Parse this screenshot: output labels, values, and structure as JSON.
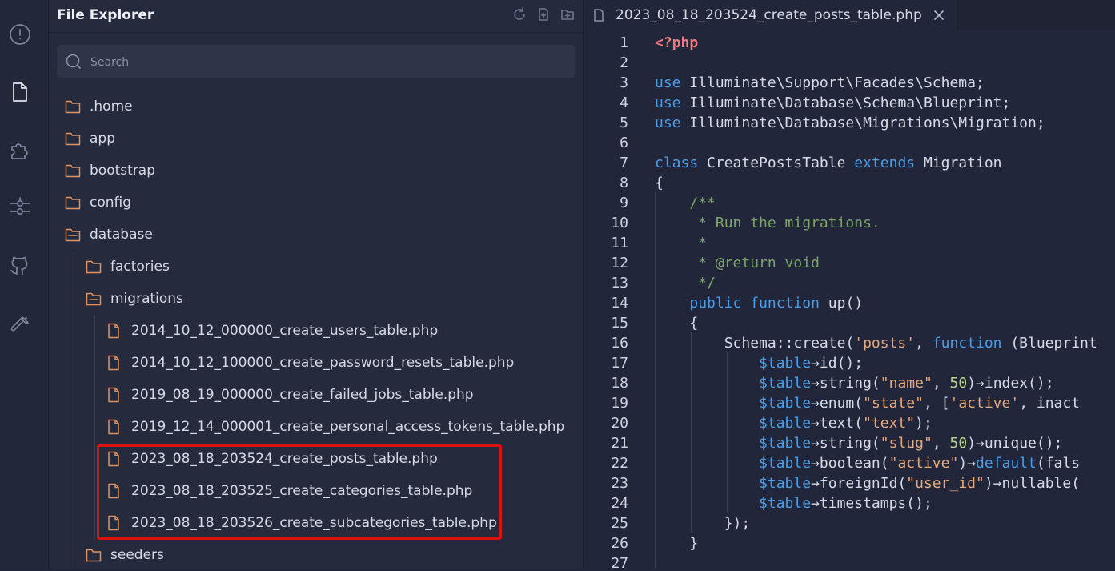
{
  "activity_bar": {
    "icons": [
      "alert-circle-icon",
      "file-icon",
      "puzzle-icon",
      "sliders-icon",
      "github-icon",
      "wrench-icon"
    ]
  },
  "sidebar": {
    "title": "File Explorer",
    "actions": [
      "refresh-icon",
      "new-file-icon",
      "new-folder-icon"
    ],
    "search_placeholder": "Search",
    "tree": [
      {
        "label": ".home",
        "type": "folder",
        "open": false
      },
      {
        "label": "app",
        "type": "folder",
        "open": false
      },
      {
        "label": "bootstrap",
        "type": "folder",
        "open": false
      },
      {
        "label": "config",
        "type": "folder",
        "open": false
      },
      {
        "label": "database",
        "type": "folder",
        "open": true
      },
      {
        "label": "factories",
        "type": "folder",
        "open": false
      },
      {
        "label": "migrations",
        "type": "folder",
        "open": true
      },
      {
        "label": "2014_10_12_000000_create_users_table.php",
        "type": "file"
      },
      {
        "label": "2014_10_12_100000_create_password_resets_table.php",
        "type": "file"
      },
      {
        "label": "2019_08_19_000000_create_failed_jobs_table.php",
        "type": "file"
      },
      {
        "label": "2019_12_14_000001_create_personal_access_tokens_table.php",
        "type": "file"
      },
      {
        "label": "2023_08_18_203524_create_posts_table.php",
        "type": "file"
      },
      {
        "label": "2023_08_18_203525_create_categories_table.php",
        "type": "file"
      },
      {
        "label": "2023_08_18_203526_create_subcategories_table.php",
        "type": "file"
      },
      {
        "label": "seeders",
        "type": "folder",
        "open": false
      }
    ],
    "highlight_color": "#e01010"
  },
  "editor": {
    "tab_label": "2023_08_18_203524_create_posts_table.php",
    "line_numbers": [
      "1",
      "2",
      "3",
      "4",
      "5",
      "6",
      "7",
      "8",
      "9",
      "10",
      "11",
      "12",
      "13",
      "14",
      "15",
      "16",
      "17",
      "18",
      "19",
      "20",
      "21",
      "22",
      "23",
      "24",
      "25",
      "26",
      "27"
    ],
    "lines": [
      "<?php",
      "",
      "use Illuminate\\Support\\Facades\\Schema;",
      "use Illuminate\\Database\\Schema\\Blueprint;",
      "use Illuminate\\Database\\Migrations\\Migration;",
      "",
      "class CreatePostsTable extends Migration",
      "{",
      "    /**",
      "     * Run the migrations.",
      "     *",
      "     * @return void",
      "     */",
      "    public function up()",
      "    {",
      "        Schema::create('posts', function (Blueprint",
      "            $table→id();",
      "            $table→string(\"name\", 50)→index();",
      "            $table→enum(\"state\", ['active', 'inact",
      "            $table→text(\"text\");",
      "            $table→string(\"slug\", 50)→unique();",
      "            $table→boolean(\"active\")→default(fals",
      "            $table→foreignId(\"user_id\")→nullable(",
      "            $table→timestamps();",
      "        });",
      "    }",
      ""
    ]
  }
}
